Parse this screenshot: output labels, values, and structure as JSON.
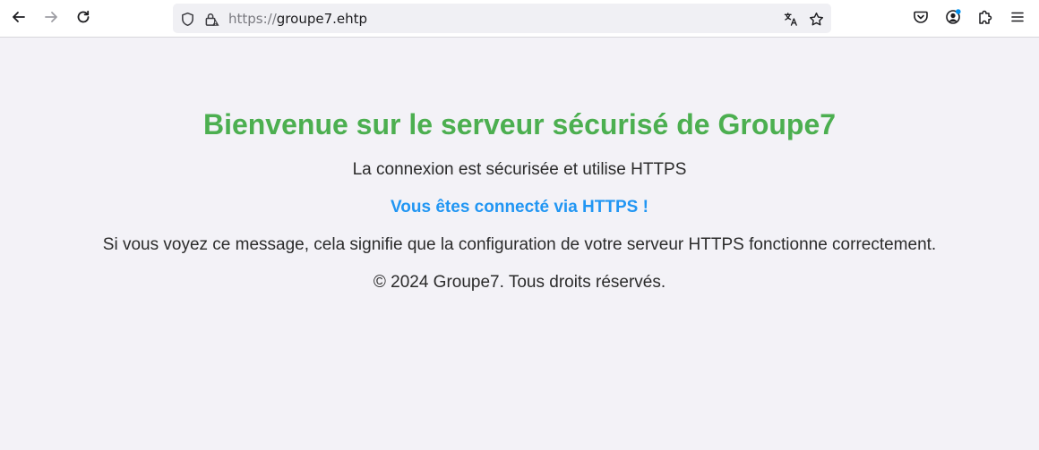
{
  "browser": {
    "url_scheme": "https://",
    "url_host": "groupe7.ehtp",
    "icons": {
      "back": "arrow-left-icon",
      "forward": "arrow-right-icon",
      "reload": "reload-icon",
      "tracking_protection": "shield-icon",
      "connection": "lock-warning-icon",
      "translate": "translate-icon",
      "bookmark": "star-icon",
      "pocket": "pocket-icon",
      "account": "account-icon",
      "extensions": "puzzle-icon",
      "menu": "hamburger-menu-icon"
    },
    "colors": {
      "toolbar": "#ffffff",
      "urlbar": "#f0f0f4",
      "account_badge": "#0090ed"
    }
  },
  "page": {
    "heading": "Bienvenue sur le serveur sécurisé de Groupe7",
    "subtitle": "La connexion est sécurisée et utilise HTTPS",
    "status": "Vous êtes connecté via HTTPS !",
    "message": "Si vous voyez ce message, cela signifie que la configuration de votre serveur HTTPS fonctionne correctement.",
    "footer": "© 2024 Groupe7. Tous droits réservés.",
    "colors": {
      "background": "#f3f2f7",
      "heading": "#4caf50",
      "status": "#2196f3",
      "text": "#2b2b2b"
    }
  }
}
